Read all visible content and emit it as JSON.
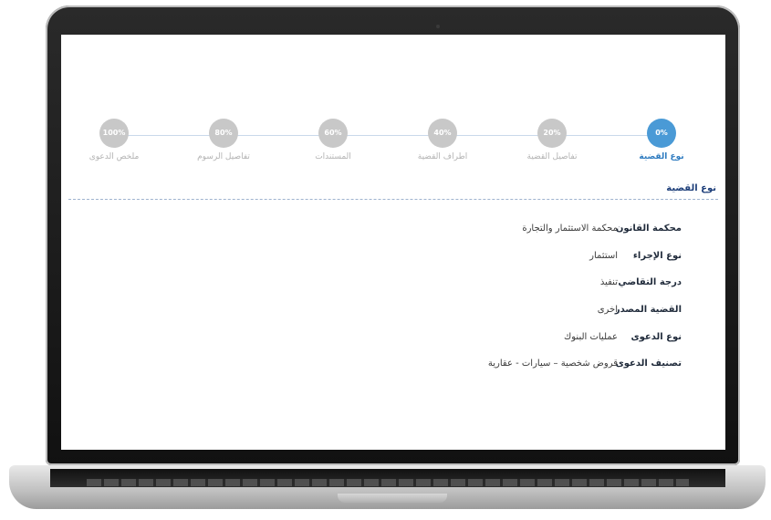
{
  "stepper": {
    "steps": [
      {
        "percent": "0%",
        "label": "نوع القضية",
        "active": true
      },
      {
        "percent": "20%",
        "label": "تفاصيل القضية",
        "active": false
      },
      {
        "percent": "40%",
        "label": "اطراف القضية",
        "active": false
      },
      {
        "percent": "60%",
        "label": "المستندات",
        "active": false
      },
      {
        "percent": "80%",
        "label": "تفاصيل الرسوم",
        "active": false
      },
      {
        "percent": "100%",
        "label": "ملخص الدعوى",
        "active": false
      }
    ]
  },
  "section": {
    "title": "نوع القضية"
  },
  "details": [
    {
      "label": "محكمة القانون",
      "value": "محكمة الاستثمار والتجارة"
    },
    {
      "label": "نوع الإجراء",
      "value": "استثمار"
    },
    {
      "label": "درجة التقاضي",
      "value": "تنفيذ"
    },
    {
      "label": "القضية المصدر",
      "value": "اخرى"
    },
    {
      "label": "نوع الدعوى",
      "value": "عمليات البنوك"
    },
    {
      "label": "تصنيف الدعوى",
      "value": "قروض شخصية – سيارات - عقارية"
    }
  ],
  "colors": {
    "active_step": "#4a9ad6",
    "inactive_step": "#c8c8c8",
    "section_title": "#1e3f7a"
  }
}
